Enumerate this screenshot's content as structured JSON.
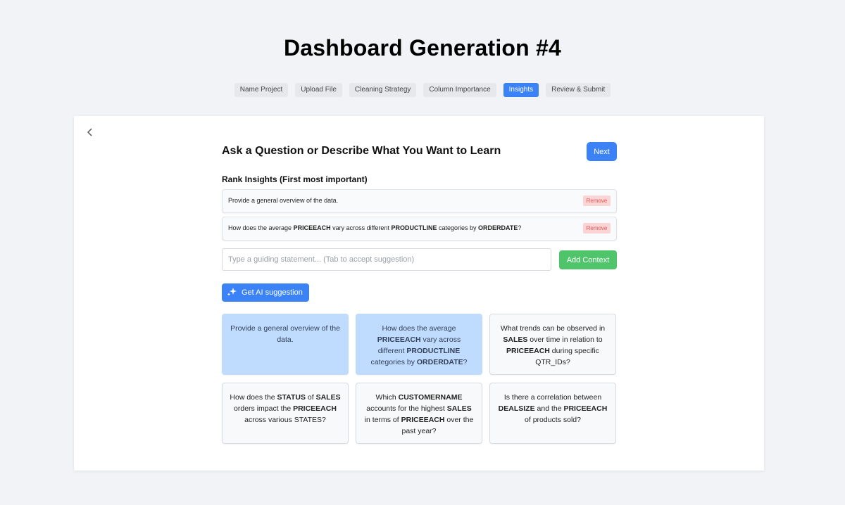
{
  "page": {
    "title": "Dashboard Generation #4"
  },
  "steps": [
    {
      "label": "Name Project",
      "active": false
    },
    {
      "label": "Upload File",
      "active": false
    },
    {
      "label": "Cleaning Strategy",
      "active": false
    },
    {
      "label": "Column Importance",
      "active": false
    },
    {
      "label": "Insights",
      "active": true
    },
    {
      "label": "Review & Submit",
      "active": false
    }
  ],
  "panel": {
    "heading": "Ask a Question or Describe What You Want to Learn",
    "next_label": "Next",
    "rank_label": "Rank Insights (First most important)",
    "remove_label": "Remove",
    "ranked": [
      "Provide a general overview of the data.",
      "How does the average **PRICEEACH** vary across different **PRODUCTLINE** categories by **ORDERDATE**?"
    ],
    "input": {
      "placeholder": "Type a guiding statement... (Tab to accept suggestion)",
      "value": ""
    },
    "add_context_label": "Add Context",
    "ai_suggestion_label": "Get AI suggestion"
  },
  "suggestions": [
    {
      "text": "Provide a general overview of the data.",
      "selected": true
    },
    {
      "text": "How does the average **PRICEEACH** vary across different **PRODUCTLINE** categories by **ORDERDATE**?",
      "selected": true
    },
    {
      "text": "What trends can be observed in **SALES** over time in relation to **PRICEEACH** during specific QTR_IDs?",
      "selected": false
    },
    {
      "text": "How does the **STATUS** of **SALES** orders impact the **PRICEEACH** across various STATES?",
      "selected": false
    },
    {
      "text": "Which **CUSTOMERNAME** accounts for the highest **SALES** in terms of **PRICEEACH** over the past year?",
      "selected": false
    },
    {
      "text": "Is there a correlation between **DEALSIZE** and the **PRICEEACH** of products sold?",
      "selected": false
    }
  ],
  "colors": {
    "accent": "#3b82f6",
    "success": "#4fc46a",
    "danger_bg": "#fbd5d5",
    "selected_bg": "#bfdbfe"
  }
}
